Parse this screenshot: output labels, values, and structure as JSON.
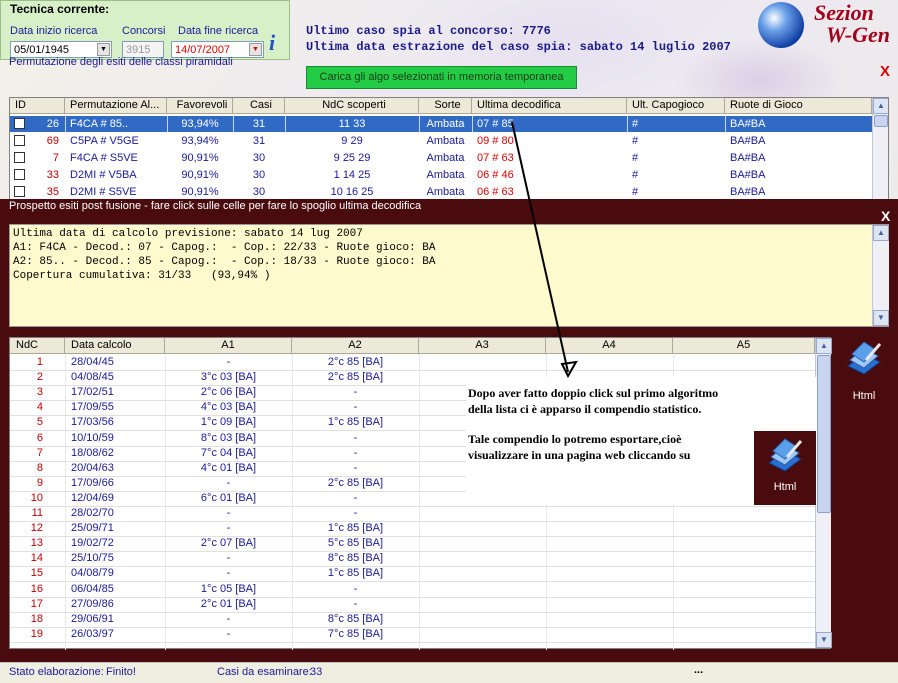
{
  "tecnica": {
    "title": "Tecnica corrente:",
    "data_inizio_label": "Data inizio ricerca",
    "data_inizio_value": "05/01/1945",
    "concorsi_label": "Concorsi",
    "concorsi_value": "3915",
    "data_fine_label": "Data fine ricerca",
    "data_fine_value": "14/07/2007"
  },
  "caso_spia": {
    "line1": "Ultimo caso spia al concorso: 7776",
    "line2": "Ultima data estrazione del caso spia: sabato 14 luglio 2007"
  },
  "brand": {
    "line1": "Sezion",
    "line2": "W-Gen"
  },
  "perm_label": "Permutazione degli esiti delle classi piramidali",
  "load_button": "Carica gli algo selezionati in memoria temporanea",
  "close_x": "X",
  "top_table": {
    "headers": [
      "ID",
      "Permutazione Al...",
      "Favorevoli",
      "Casi",
      "NdC scoperti",
      "Sorte",
      "Ultima decodifica",
      "Ult. Capogioco",
      "Ruote di Gioco"
    ],
    "rows": [
      {
        "id": "26",
        "perm": "F4CA # 85..",
        "fav": "93,94%",
        "casi": "31",
        "ndc": "11 33",
        "sorte": "Ambata",
        "ult": "07 # 85",
        "cap": "#",
        "ruote": "BA#BA",
        "selected": true
      },
      {
        "id": "69",
        "perm": "C5PA # V5GE",
        "fav": "93,94%",
        "casi": "31",
        "ndc": "9 29",
        "sorte": "Ambata",
        "ult": "09 # 80",
        "cap": "#",
        "ruote": "BA#BA"
      },
      {
        "id": "7",
        "perm": "F4CA # S5VE",
        "fav": "90,91%",
        "casi": "30",
        "ndc": "9 25 29",
        "sorte": "Ambata",
        "ult": "07 # 63",
        "cap": "#",
        "ruote": "BA#BA"
      },
      {
        "id": "33",
        "perm": "D2MI # V5BA",
        "fav": "90,91%",
        "casi": "30",
        "ndc": "1 14 25",
        "sorte": "Ambata",
        "ult": "06 # 46",
        "cap": "#",
        "ruote": "BA#BA"
      },
      {
        "id": "35",
        "perm": "D2MI # S5VE",
        "fav": "90,91%",
        "casi": "30",
        "ndc": "10 16 25",
        "sorte": "Ambata",
        "ult": "06 # 63",
        "cap": "#",
        "ruote": "BA#BA"
      }
    ]
  },
  "prospetto": {
    "title": "Prospetto esiti post fusione - fare click sulle celle per fare lo spoglio ultima decodifica",
    "close": "X"
  },
  "notes": {
    "lines": [
      "Ultima data di calcolo previsione: sabato 14 lug 2007",
      "A1: F4CA - Decod.: 07 - Capog.:  - Cop.: 22/33 - Ruote gioco: BA",
      "A2: 85.. - Decod.: 85 - Capog.:  - Cop.: 18/33 - Ruote gioco: BA",
      "Copertura cumulativa: 31/33   (93,94% )"
    ]
  },
  "grid": {
    "headers": [
      "NdC",
      "Data calcolo",
      "A1",
      "A2",
      "A3",
      "A4",
      "A5"
    ],
    "rows": [
      [
        "1",
        "28/04/45",
        "-",
        "2°c 85 [BA]"
      ],
      [
        "2",
        "04/08/45",
        "3°c 03 [BA]",
        "2°c 85 [BA]"
      ],
      [
        "3",
        "17/02/51",
        "2°c 06 [BA]",
        "-"
      ],
      [
        "4",
        "17/09/55",
        "4°c 03 [BA]",
        "-"
      ],
      [
        "5",
        "17/03/56",
        "1°c 09 [BA]",
        "1°c 85 [BA]"
      ],
      [
        "6",
        "10/10/59",
        "8°c 03 [BA]",
        "-"
      ],
      [
        "7",
        "18/08/62",
        "7°c 04 [BA]",
        "-"
      ],
      [
        "8",
        "20/04/63",
        "4°c 01 [BA]",
        "-"
      ],
      [
        "9",
        "17/09/66",
        "-",
        "2°c 85 [BA]"
      ],
      [
        "10",
        "12/04/69",
        "6°c 01 [BA]",
        "-"
      ],
      [
        "11",
        "28/02/70",
        "-",
        "-"
      ],
      [
        "12",
        "25/09/71",
        "-",
        "1°c 85 [BA]"
      ],
      [
        "13",
        "19/02/72",
        "2°c 07 [BA]",
        "5°c 85 [BA]"
      ],
      [
        "14",
        "25/10/75",
        "-",
        "8°c 85 [BA]"
      ],
      [
        "15",
        "04/08/79",
        "-",
        "1°c 85 [BA]"
      ],
      [
        "16",
        "06/04/85",
        "1°c 05 [BA]",
        "-"
      ],
      [
        "17",
        "27/09/86",
        "2°c 01 [BA]",
        "-"
      ],
      [
        "18",
        "29/06/91",
        "-",
        "8°c 85 [BA]"
      ],
      [
        "19",
        "26/03/97",
        "-",
        "7°c 85 [BA]"
      ]
    ]
  },
  "html_label": "Html",
  "callout": {
    "line1": "Dopo aver fatto doppio click sul primo algoritmo",
    "line2": "della lista ci è apparso il compendio statistico.",
    "line3": "Tale compendio lo potremo esportare,cioè",
    "line4": "visualizzare in una pagina web cliccando su",
    "html_label": "Html"
  },
  "status": {
    "stato_label": "Stato elaborazione:",
    "stato_value": "Finito!",
    "casi_label": "Casi da esaminare:",
    "casi_value": "33",
    "dots": "..."
  },
  "colors": {
    "header_bg": "#ece9d8",
    "selected_row": "#316ac5",
    "maroon": "#4a0b0f",
    "notes_bg": "#fffacd",
    "green_button": "#22cc44"
  }
}
